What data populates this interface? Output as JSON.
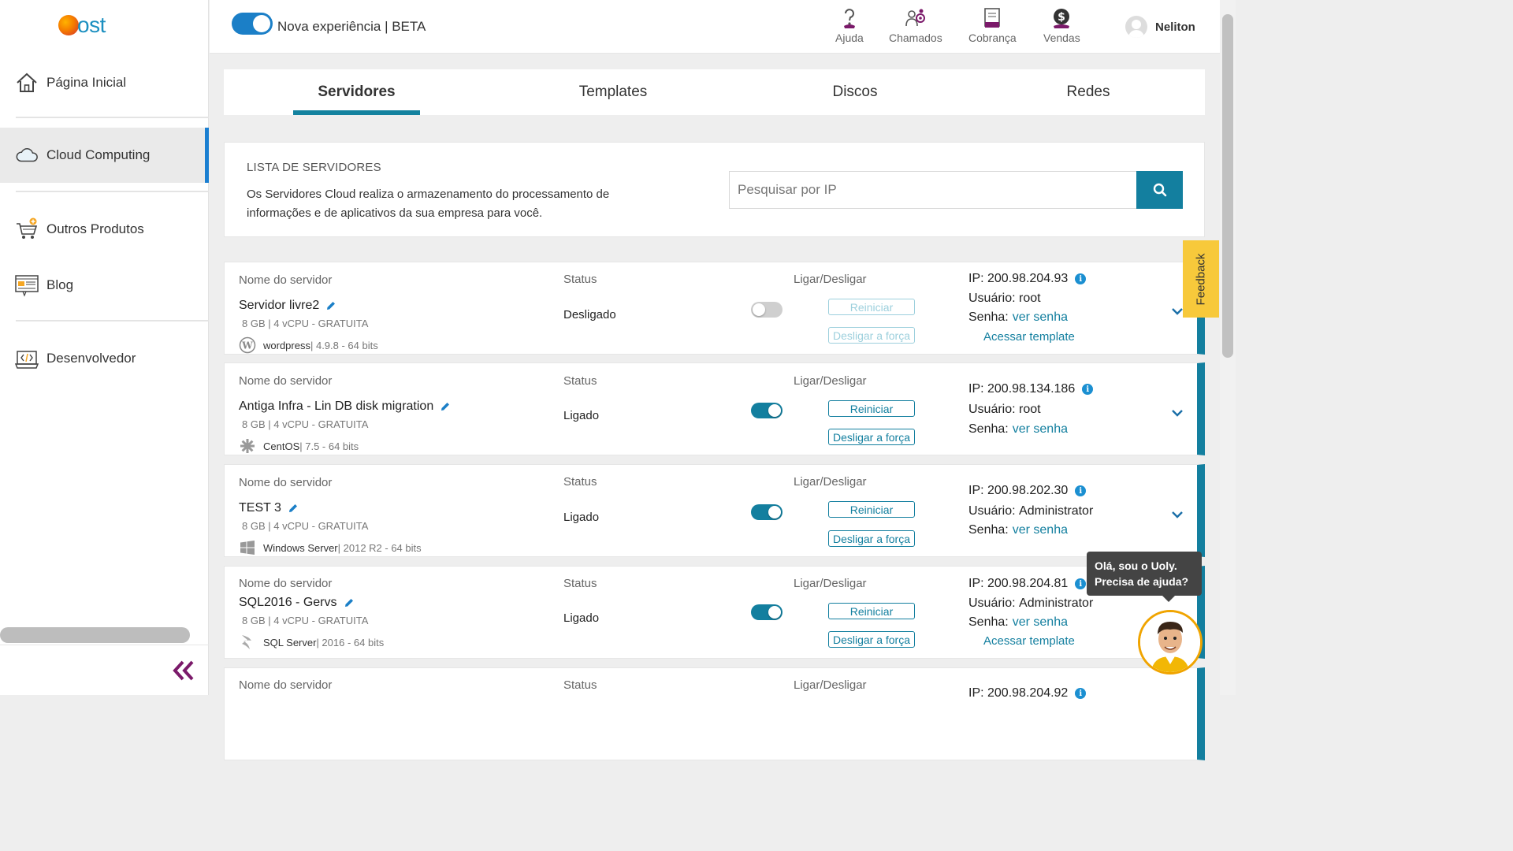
{
  "brand": {
    "logo_text": "ost"
  },
  "sidebar": {
    "items": [
      {
        "label": "Página Inicial"
      },
      {
        "label": "Cloud Computing"
      },
      {
        "label": "Outros Produtos"
      },
      {
        "label": "Blog"
      },
      {
        "label": "Desenvolvedor"
      }
    ]
  },
  "header": {
    "beta_label": "Nova experiência | BETA",
    "nav": [
      {
        "label": "Ajuda"
      },
      {
        "label": "Chamados"
      },
      {
        "label": "Cobrança"
      },
      {
        "label": "Vendas"
      }
    ],
    "user_name": "Neliton"
  },
  "tabs": [
    {
      "label": "Servidores"
    },
    {
      "label": "Templates"
    },
    {
      "label": "Discos"
    },
    {
      "label": "Redes"
    }
  ],
  "intro": {
    "title": "LISTA DE SERVIDORES",
    "description": "Os Servidores Cloud realiza o armazenamento do processamento de informações e de aplicativos da sua empresa para você.",
    "search_placeholder": "Pesquisar por IP"
  },
  "labels": {
    "server_name": "Nome do servidor",
    "status": "Status",
    "power": "Ligar/Desligar",
    "restart": "Reiniciar",
    "force_off": "Desligar a força",
    "user_prefix": "Usuário:",
    "password_prefix": "Senha:",
    "show_password": "ver senha",
    "access_template": "Acessar template"
  },
  "servers": [
    {
      "name": "Servidor livre2",
      "spec": "8 GB  | 4 vCPU - GRATUITA",
      "os": "wordpress",
      "os_version": " | 4.9.8 - 64 bits",
      "status": "Desligado",
      "ip": "IP: 200.98.204.93",
      "user": "root"
    },
    {
      "name": "Antiga Infra - Lin DB disk migration",
      "spec": "8 GB  | 4 vCPU - GRATUITA",
      "os": "CentOS",
      "os_version": " | 7.5 - 64 bits",
      "status": "Ligado",
      "ip": "IP: 200.98.134.186",
      "user": "root"
    },
    {
      "name": "TEST 3",
      "spec": "8 GB  | 4 vCPU - GRATUITA",
      "os": "Windows Server",
      "os_version": " | 2012 R2 - 64 bits",
      "status": "Ligado",
      "ip": "IP: 200.98.202.30",
      "user": "Administrator"
    },
    {
      "name": "SQL2016 - Gervs",
      "spec": "8 GB  | 4 vCPU - GRATUITA",
      "os": "SQL Server",
      "os_version": " | 2016 - 64 bits",
      "status": "Ligado",
      "ip": "IP: 200.98.204.81",
      "user": "Administrator"
    },
    {
      "ip": "IP: 200.98.204.92"
    }
  ],
  "feedback_label": "Feedback",
  "chat": {
    "line1": "Olá, sou o Uoly.",
    "line2": "Precisa de ajuda?"
  },
  "colors": {
    "primary": "#137f9f",
    "active_indicator": "#1b7fd1",
    "feedback": "#f7c93b",
    "info": "#1b8fd1"
  },
  "icons": {
    "sidebar": [
      "home-icon",
      "cloud-icon",
      "cart-icon",
      "blog-icon",
      "developer-icon"
    ],
    "header": [
      "question-icon",
      "tickets-icon",
      "billing-icon",
      "sales-icon"
    ]
  }
}
